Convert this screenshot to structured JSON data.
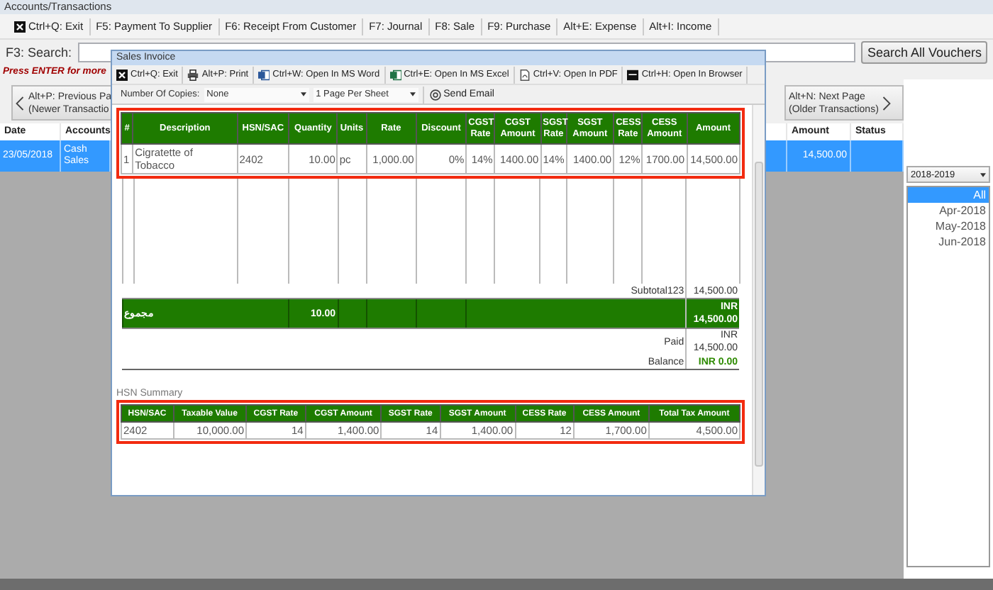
{
  "window": {
    "title": "Accounts/Transactions"
  },
  "toolbar": [
    {
      "kind": "exit",
      "label": "Ctrl+Q: Exit"
    },
    {
      "kind": "plain",
      "label": "F5: Payment To Supplier"
    },
    {
      "kind": "plain",
      "label": "F6: Receipt From Customer"
    },
    {
      "kind": "plain",
      "label": "F7: Journal"
    },
    {
      "kind": "plain",
      "label": "F8: Sale"
    },
    {
      "kind": "plain",
      "label": "F9: Purchase"
    },
    {
      "kind": "plain",
      "label": "Alt+E: Expense"
    },
    {
      "kind": "plain",
      "label": "Alt+I: Income"
    }
  ],
  "search": {
    "label": "F3: Search:",
    "button": "Search All Vouchers",
    "hint": "Press ENTER for more"
  },
  "nav": {
    "previous": [
      "Alt+P: Previous Pa",
      "(Newer Transactio"
    ],
    "next": [
      "Alt+N: Next Page",
      "(Older Transactions)"
    ]
  },
  "table": {
    "columns": [
      "Date",
      "Accounts",
      "Amount",
      "Status"
    ],
    "rows": [
      {
        "date": "23/05/2018",
        "account": "Cash Sales",
        "amount": "14,500.00",
        "selected": true
      }
    ]
  },
  "filter": {
    "year": "2018-2019",
    "periods": [
      {
        "label": "All",
        "selected": true
      },
      {
        "label": "Apr-2018",
        "selected": false
      },
      {
        "label": "May-2018",
        "selected": false
      },
      {
        "label": "Jun-2018",
        "selected": false
      }
    ]
  },
  "invoice_dialog": {
    "title": "Sales Invoice",
    "toolbar": [
      {
        "kind": "exit",
        "label": "Ctrl+Q: Exit"
      },
      {
        "kind": "print",
        "label": "Alt+P: Print"
      },
      {
        "kind": "word",
        "label": "Ctrl+W: Open In MS Word"
      },
      {
        "kind": "excel",
        "label": "Ctrl+E: Open In MS Excel"
      },
      {
        "kind": "pdf",
        "label": "Ctrl+V: Open In PDF"
      },
      {
        "kind": "browser",
        "label": "Ctrl+H: Open In Browser"
      }
    ],
    "copies_label": "Number Of Copies:",
    "copies": "None",
    "layout": "1 Page Per Sheet",
    "email": "Send Email",
    "items": {
      "columns": [
        "#",
        "Description",
        "HSN/SAC",
        "Quantity",
        "Units",
        "Rate",
        "Discount",
        "CGST Rate",
        "CGST Amount",
        "SGST Rate",
        "SGST Amount",
        "CESS Rate",
        "CESS Amount",
        "Amount"
      ],
      "rows": [
        [
          "1",
          "Cigratette of Tobacco",
          "2402",
          "10.00",
          "pc",
          "1,000.00",
          "0%",
          "14%",
          "1400.00",
          "14%",
          "1400.00",
          "12%",
          "1700.00",
          "14,500.00"
        ]
      ]
    },
    "totals": {
      "subtotal_label": "Subtotal123",
      "subtotal": "14,500.00",
      "total_label": "مجموع",
      "total_quantity": "10.00",
      "total_amount": "INR 14,500.00",
      "paid_label": "Paid",
      "paid": "INR 14,500.00",
      "balance_label": "Balance",
      "balance": "INR 0.00"
    },
    "hsn_summary": {
      "title": "HSN Summary",
      "columns": [
        "HSN/SAC",
        "Taxable Value",
        "CGST Rate",
        "CGST Amount",
        "SGST Rate",
        "SGST Amount",
        "CESS Rate",
        "CESS Amount",
        "Total Tax Amount"
      ],
      "rows": [
        [
          "2402",
          "10,000.00",
          "14",
          "1,400.00",
          "14",
          "1,400.00",
          "12",
          "1,700.00",
          "4,500.00"
        ]
      ]
    }
  }
}
